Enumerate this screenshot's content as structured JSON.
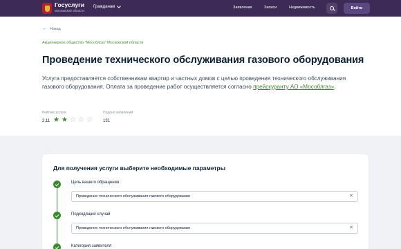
{
  "header": {
    "brand_title": "Госуслуги",
    "brand_subtitle": "Московской области",
    "citizens_label": "Гражданам",
    "nav": [
      "Заявления",
      "Записи",
      "Недвижимость"
    ],
    "login_label": "Войти"
  },
  "top": {
    "back_label": "Назад",
    "org": "Акционерное общество \"Мособлгаз\" Московской области",
    "title": "Проведение технического обслуживания газового оборудования",
    "description_text": "Услуга предоставляется собственникам квартир и частных домов с целью проведения технического обслуживания газового оборудования. Оплата за проведение работ осуществляется согласно ",
    "description_link": "прейскуранту АО «Мособлгаз»",
    "description_end": ".",
    "rating_label": "Рейтинг услуги",
    "rating_value": "2,11",
    "rating_stars": 2,
    "rating_max": 5,
    "applications_label": "Подано заявлений",
    "applications_value": "131"
  },
  "params": {
    "title": "Для получения услуги выберите необходимые параметры",
    "steps": [
      {
        "label": "Цель вашего обращения",
        "value": "Проведение технического обслуживания газового оборудования"
      },
      {
        "label": "Подходящий случай",
        "value": "Проведение технического обслуживания газового оборудования"
      },
      {
        "label": "Категория заявителя",
        "value": ""
      }
    ]
  },
  "colors": {
    "header_bg": "#3e2a56",
    "accent_green": "#3c8a2e",
    "page_bg": "#f1f2f6"
  }
}
